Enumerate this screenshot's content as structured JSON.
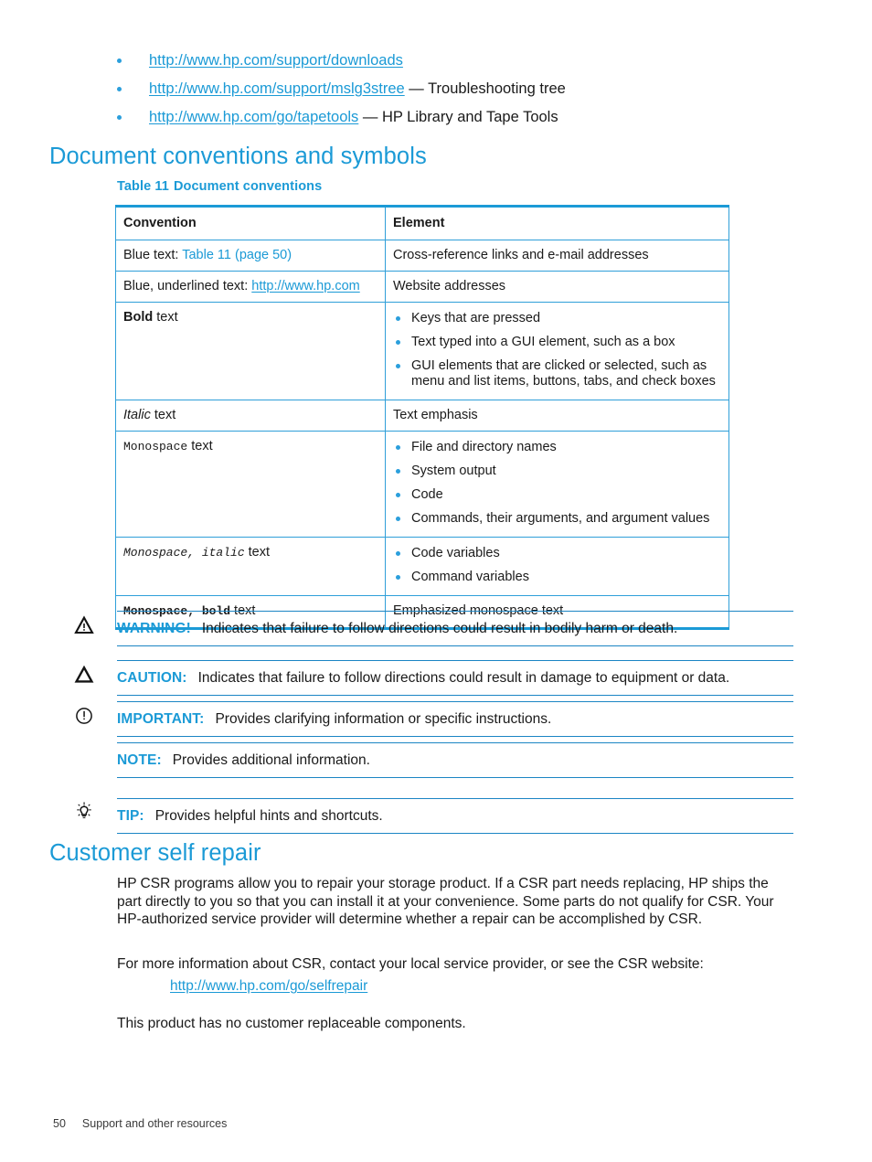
{
  "colors": {
    "hp_blue": "#1b9ad6",
    "rule_blue": "#1b85c4",
    "table_border": "#2f9fd9",
    "bullet_blue": "#2b9fdc",
    "text": "#1a1a1a"
  },
  "top_links": [
    {
      "url": "http://www.hp.com/support/downloads",
      "suffix": ""
    },
    {
      "url": "http://www.hp.com/support/mslg3stree",
      "suffix": " — Troubleshooting tree"
    },
    {
      "url": "http://www.hp.com/go/tapetools",
      "suffix": " — HP Library and Tape Tools"
    }
  ],
  "headings": {
    "document_conventions": "Document conventions and symbols",
    "customer_self_repair": "Customer self repair"
  },
  "table": {
    "caption_number": "Table 11",
    "caption_title": "Document conventions",
    "headers": [
      "Convention",
      "Element"
    ],
    "rows": [
      {
        "convention_prefix": "Blue text: ",
        "convention_link": "Table 11 (page 50)",
        "convention_link_style": "blue-plain",
        "element_text": "Cross-reference links and e-mail addresses"
      },
      {
        "convention_prefix": "Blue, underlined text: ",
        "convention_link": "http://www.hp.com",
        "convention_link_style": "blue-underline",
        "element_text": "Website addresses"
      },
      {
        "convention_styled": "Bold",
        "convention_style": "bold",
        "convention_suffix": " text",
        "element_bullets": [
          "Keys that are pressed",
          "Text typed into a GUI element, such as a box",
          "GUI elements that are clicked or selected, such as menu and list items, buttons, tabs, and check boxes"
        ]
      },
      {
        "convention_styled": "Italic",
        "convention_style": "italic",
        "convention_suffix": "  text",
        "element_text": "Text emphasis"
      },
      {
        "convention_styled": "Monospace",
        "convention_style": "mono",
        "convention_suffix": "  text",
        "element_bullets": [
          "File and directory names",
          "System output",
          "Code",
          "Commands, their arguments, and argument values"
        ]
      },
      {
        "convention_styled": "Monospace, italic",
        "convention_style": "mono-italic",
        "convention_suffix": "  text",
        "element_bullets": [
          "Code variables",
          "Command variables"
        ]
      },
      {
        "convention_styled": "Monospace, bold",
        "convention_style": "mono-bold",
        "convention_suffix": "  text",
        "element_text": "Emphasized monospace text"
      }
    ]
  },
  "admonitions": [
    {
      "icon": "warning-triangle-icon",
      "keyword": "WARNING!",
      "text": "Indicates that failure to follow directions could result in bodily harm or death."
    },
    {
      "icon": "caution-triangle-icon",
      "keyword": "CAUTION:",
      "text": "Indicates that failure to follow directions could result in damage to equipment or data."
    },
    {
      "icon": "important-circle-icon",
      "keyword": "IMPORTANT:",
      "text": "Provides clarifying information or specific instructions."
    },
    {
      "icon": "",
      "keyword": "NOTE:",
      "text": "Provides additional information."
    },
    {
      "icon": "tip-lightbulb-icon",
      "keyword": "TIP:",
      "text": "Provides helpful hints and shortcuts."
    }
  ],
  "csr": {
    "paragraph1": "HP CSR programs allow you to repair your storage product. If a CSR part needs replacing, HP ships the part directly to you so that you can install it at your convenience. Some parts do not qualify for CSR. Your HP-authorized service provider will determine whether a repair can be accomplished by CSR.",
    "paragraph2": "For more information about CSR, contact your local service provider, or see the CSR website:",
    "link": "http://www.hp.com/go/selfrepair",
    "paragraph3": "This product has no customer replaceable components."
  },
  "footer": {
    "page_number": "50",
    "chapter_title": "Support and other resources"
  }
}
